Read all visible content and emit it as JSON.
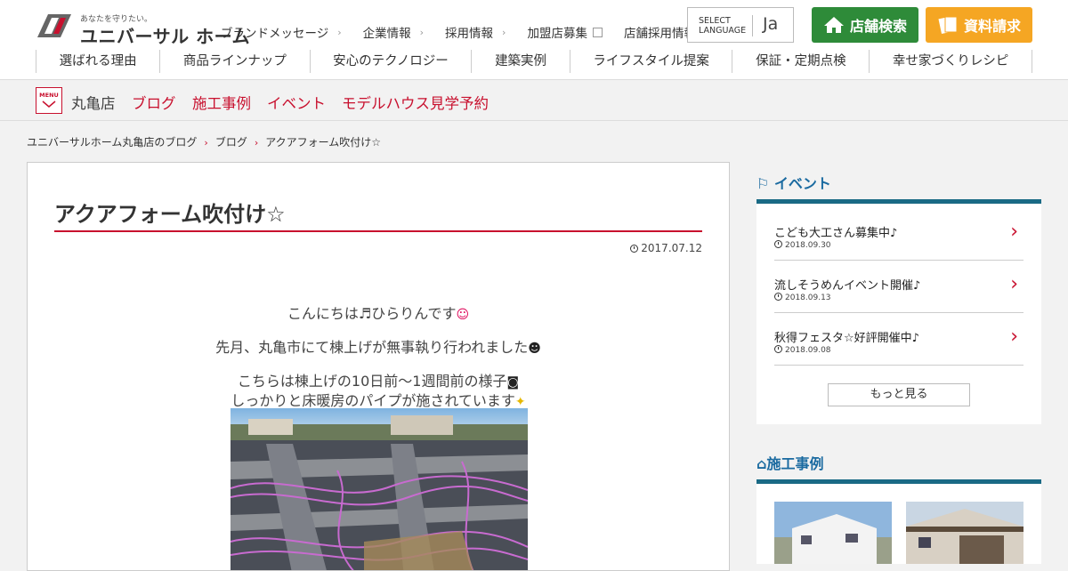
{
  "header": {
    "logo_tagline": "あなたを守りたい。",
    "logo_name": "ユニバーサル ホーム",
    "top_links": [
      {
        "label": "ブランドメッセージ",
        "external": false
      },
      {
        "label": "企業情報",
        "external": false
      },
      {
        "label": "採用情報",
        "external": false
      },
      {
        "label": "加盟店募集",
        "external": true
      },
      {
        "label": "店舗採用情報",
        "external": true
      }
    ],
    "language": {
      "line1": "SELECT",
      "line2": "LANGUAGE",
      "current": "Ja"
    },
    "store_search_label": "店舗検索",
    "request_docs_label": "資料請求",
    "main_nav": [
      "選ばれる理由",
      "商品ラインナップ",
      "安心のテクノロジー",
      "建築実例",
      "ライフスタイル提案",
      "保証・定期点検",
      "幸せ家づくりレシピ"
    ]
  },
  "store_bar": {
    "menu_label": "MENU",
    "store_name": "丸亀店",
    "links": [
      "ブログ",
      "施工事例",
      "イベント",
      "モデルハウス見学予約"
    ]
  },
  "breadcrumb": [
    "ユニバーサルホーム丸亀店のブログ",
    "ブログ",
    "アクアフォーム吹付け☆"
  ],
  "article": {
    "title": "アクアフォーム吹付け☆",
    "date": "2017.07.12",
    "paragraphs": [
      "こんにちは♬ひらりんです",
      "先月、丸亀市にて棟上げが無事執り行われました",
      "こちらは棟上げの10日前～1週間前の様子",
      "しっかりと床暖房のパイプが施されています"
    ]
  },
  "sidebar": {
    "events_heading": "イベント",
    "events": [
      {
        "title": "こども大工さん募集中♪",
        "date": "2018.09.30"
      },
      {
        "title": "流しそうめんイベント開催♪",
        "date": "2018.09.13"
      },
      {
        "title": "秋得フェスタ☆好評開催中♪",
        "date": "2018.09.08"
      }
    ],
    "more_label": "もっと見る",
    "cases_heading": "施工事例"
  },
  "colors": {
    "brand_red": "#c8102e",
    "green": "#2e8b39",
    "orange": "#f5a623",
    "teal": "#1a6a85"
  }
}
